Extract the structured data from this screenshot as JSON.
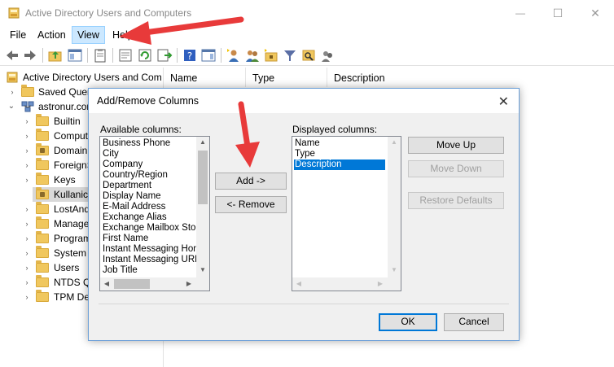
{
  "window": {
    "title": "Active Directory Users and Computers",
    "controls": {
      "minimize": "—",
      "maximize": "☐",
      "close": "✕"
    }
  },
  "menu": {
    "items": [
      "File",
      "Action",
      "View",
      "Help"
    ],
    "active_index": 2
  },
  "tree": {
    "root_label": "Active Directory Users and Com",
    "saved_queries": "Saved Queri",
    "domain": "astronur.cor",
    "children": [
      "Builtin",
      "Comput",
      "Domain",
      "ForeignS",
      "Keys",
      "Kullanici",
      "LostAnd",
      "Manage",
      "Program",
      "System",
      "Users",
      "NTDS Qu",
      "TPM Dev"
    ],
    "selected": "Kullanici"
  },
  "list": {
    "columns": [
      "Name",
      "Type",
      "Description"
    ]
  },
  "dialog": {
    "title": "Add/Remove Columns",
    "close": "✕",
    "available_label": "Available columns:",
    "available_items": [
      "Business Phone",
      "City",
      "Company",
      "Country/Region",
      "Department",
      "Display Name",
      "E-Mail Address",
      "Exchange Alias",
      "Exchange Mailbox Store",
      "First Name",
      "Instant Messaging Hom",
      "Instant Messaging URL",
      "Job Title"
    ],
    "displayed_label": "Displayed columns:",
    "displayed_items": [
      "Name",
      "Type",
      "Description"
    ],
    "displayed_selected": "Description",
    "add_button": "Add ->",
    "remove_button": "<- Remove",
    "move_up_button": "Move Up",
    "move_down_button": "Move Down",
    "restore_button": "Restore Defaults",
    "ok_button": "OK",
    "cancel_button": "Cancel"
  },
  "colors": {
    "selection": "#0078d7",
    "menu_active": "#cce8ff",
    "annotation_arrow": "#e83a3a",
    "folder": "#f0c75e"
  }
}
